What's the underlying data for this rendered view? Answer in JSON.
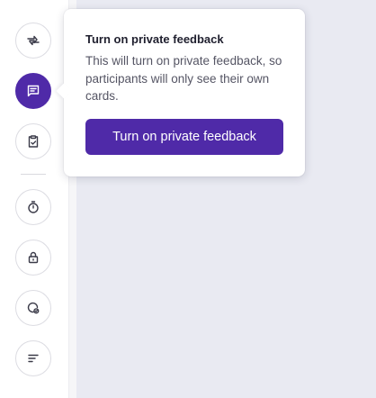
{
  "toolbar": {
    "items": [
      {
        "icon": "swap-arrows-icon",
        "active": false
      },
      {
        "icon": "message-lines-icon",
        "active": true
      },
      {
        "icon": "clipboard-check-icon",
        "active": false
      },
      {
        "icon": "timer-icon",
        "active": false
      },
      {
        "icon": "lock-icon",
        "active": false
      },
      {
        "icon": "badge-check-icon",
        "active": false
      },
      {
        "icon": "sort-lines-icon",
        "active": false
      }
    ]
  },
  "popover": {
    "title": "Turn on private feedback",
    "body": "This will turn on private feedback, so participants will only see their own cards.",
    "button_label": "Turn on private feedback"
  },
  "colors": {
    "accent": "#4f2aa8",
    "canvas": "#e9eaf2",
    "icon": "#3a3a48"
  }
}
